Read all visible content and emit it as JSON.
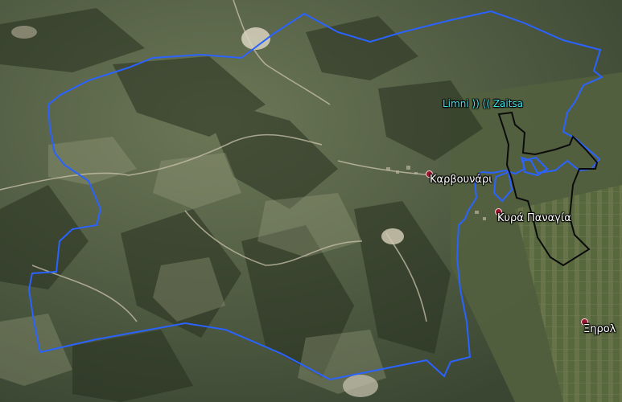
{
  "map": {
    "type": "satellite",
    "features": {
      "blue_boundary_color": "#2a63ff",
      "black_boundary_color": "#0b0b0b"
    },
    "labels": {
      "limni_zaitsa": "Limni )) (( Zaitsa",
      "karvounari": "Καρβουνάρι",
      "kyra_panagia": "Κυρά Παναγία",
      "xirol": "Ξηρολ"
    },
    "placemark_color": "#9c1530"
  }
}
